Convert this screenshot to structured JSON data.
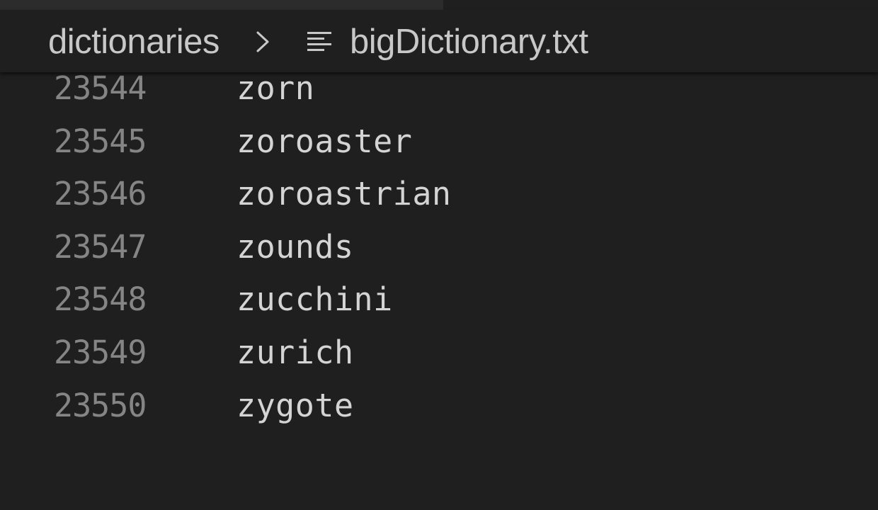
{
  "tab_strip": {},
  "breadcrumb": {
    "folder": "dictionaries",
    "separator_icon": "chevron-right-icon",
    "file_icon": "text-lines-icon",
    "file": "bigDictionary.txt"
  },
  "editor": {
    "lines": [
      {
        "number": "23544",
        "text": "zorn"
      },
      {
        "number": "23545",
        "text": "zoroaster"
      },
      {
        "number": "23546",
        "text": "zoroastrian"
      },
      {
        "number": "23547",
        "text": "zounds"
      },
      {
        "number": "23548",
        "text": "zucchini"
      },
      {
        "number": "23549",
        "text": "zurich"
      },
      {
        "number": "23550",
        "text": "zygote"
      }
    ]
  },
  "colors": {
    "background": "#1f1f1f",
    "line_number": "#858585",
    "text": "#d4d4d4",
    "breadcrumb_text": "#c8c8c8"
  }
}
